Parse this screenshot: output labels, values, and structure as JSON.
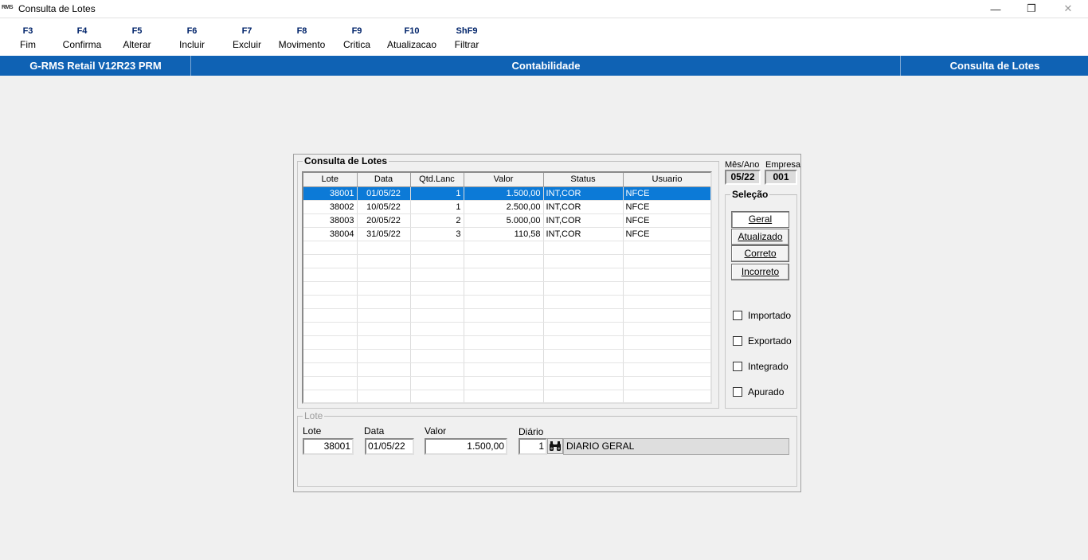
{
  "window": {
    "title": "Consulta de Lotes",
    "app_icon_text": "RMS",
    "minimize_glyph": "—",
    "maximize_glyph": "❐",
    "close_glyph": "✕"
  },
  "toolbar": {
    "keys": [
      {
        "key": "F3",
        "label": "Fim"
      },
      {
        "key": "F4",
        "label": "Confirma"
      },
      {
        "key": "F5",
        "label": "Alterar"
      },
      {
        "key": "F6",
        "label": "Incluir"
      },
      {
        "key": "F7",
        "label": "Excluir"
      },
      {
        "key": "F8",
        "label": "Movimento"
      },
      {
        "key": "F9",
        "label": "Critica"
      },
      {
        "key": "F10",
        "label": "Atualizacao"
      },
      {
        "key": "ShF9",
        "label": "Filtrar"
      }
    ]
  },
  "header_band": {
    "product": "G-RMS Retail V12R23 PRM",
    "module": "Contabilidade",
    "screen": "Consulta de Lotes",
    "color": "#0f62b4"
  },
  "consulta": {
    "legend": "Consulta de Lotes",
    "columns": [
      "Lote",
      "Data",
      "Qtd.Lanc",
      "Valor",
      "Status",
      "Usuario"
    ],
    "rows": [
      {
        "lote": "38001",
        "data": "01/05/22",
        "qtd": "1",
        "valor": "1.500,00",
        "status": "INT,COR",
        "usuario": "NFCE",
        "selected": true
      },
      {
        "lote": "38002",
        "data": "10/05/22",
        "qtd": "1",
        "valor": "2.500,00",
        "status": "INT,COR",
        "usuario": "NFCE",
        "selected": false
      },
      {
        "lote": "38003",
        "data": "20/05/22",
        "qtd": "2",
        "valor": "5.000,00",
        "status": "INT,COR",
        "usuario": "NFCE",
        "selected": false
      },
      {
        "lote": "38004",
        "data": "31/05/22",
        "qtd": "3",
        "valor": "110,58",
        "status": "INT,COR",
        "usuario": "NFCE",
        "selected": false
      }
    ],
    "selection_color": "#0c7ad7"
  },
  "info": {
    "mes_ano_label": "Mês/Ano",
    "mes_ano_value": "05/22",
    "empresa_label": "Empresa",
    "empresa_value": "001"
  },
  "selecao": {
    "legend": "Seleção",
    "buttons": [
      "Geral",
      "Atualizado",
      "Correto",
      "Incorreto"
    ],
    "checkboxes": [
      "Importado",
      "Exportado",
      "Integrado",
      "Apurado"
    ]
  },
  "lote_detail": {
    "legend": "Lote",
    "lote_label": "Lote",
    "lote_value": "38001",
    "data_label": "Data",
    "data_value": "01/05/22",
    "valor_label": "Valor",
    "valor_value": "1.500,00",
    "diario_label": "Diário",
    "diario_value": "1",
    "diario_desc": "DIARIO GERAL",
    "lookup_icon": "binoculars-icon"
  }
}
